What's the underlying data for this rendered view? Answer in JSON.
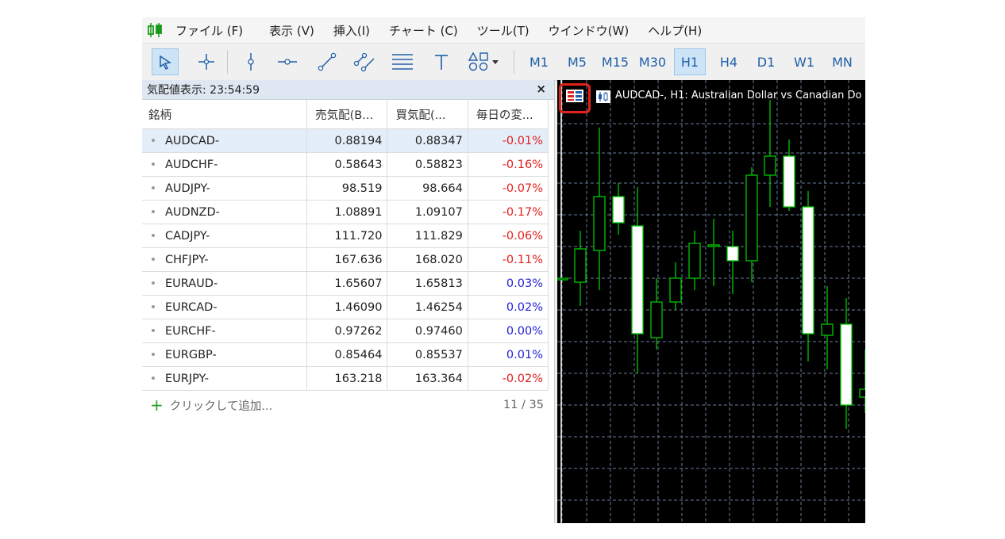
{
  "menu": [
    "ファイル (F)",
    "表示 (V)",
    "挿入(I)",
    "チャート (C)",
    "ツール(T)",
    "ウインドウ(W)",
    "ヘルプ(H)"
  ],
  "toolbar": {
    "tools": [
      "cursor-icon",
      "crosshair-icon",
      "vertical-line-icon",
      "horizontal-line-icon",
      "trendline-icon",
      "channel-icon",
      "fibonacci-icon",
      "text-icon",
      "shapes-icon"
    ],
    "timeframes": [
      "M1",
      "M5",
      "M15",
      "M30",
      "H1",
      "H4",
      "D1",
      "W1",
      "MN"
    ],
    "active_timeframe": "H1"
  },
  "market_watch": {
    "title": "気配値表示: 23:54:59",
    "columns": [
      "銘柄",
      "売気配(B...",
      "買気配(...",
      "毎日の変..."
    ],
    "rows": [
      {
        "symbol": "AUDCAD-",
        "bid": "0.88194",
        "ask": "0.88347",
        "change": "-0.01%"
      },
      {
        "symbol": "AUDCHF-",
        "bid": "0.58643",
        "ask": "0.58823",
        "change": "-0.16%"
      },
      {
        "symbol": "AUDJPY-",
        "bid": "98.519",
        "ask": "98.664",
        "change": "-0.07%"
      },
      {
        "symbol": "AUDNZD-",
        "bid": "1.08891",
        "ask": "1.09107",
        "change": "-0.17%"
      },
      {
        "symbol": "CADJPY-",
        "bid": "111.720",
        "ask": "111.829",
        "change": "-0.06%"
      },
      {
        "symbol": "CHFJPY-",
        "bid": "167.636",
        "ask": "168.020",
        "change": "-0.11%"
      },
      {
        "symbol": "EURAUD-",
        "bid": "1.65607",
        "ask": "1.65813",
        "change": "0.03%"
      },
      {
        "symbol": "EURCAD-",
        "bid": "1.46090",
        "ask": "1.46254",
        "change": "0.02%"
      },
      {
        "symbol": "EURCHF-",
        "bid": "0.97262",
        "ask": "0.97460",
        "change": "0.00%"
      },
      {
        "symbol": "EURGBP-",
        "bid": "0.85464",
        "ask": "0.85537",
        "change": "0.01%"
      },
      {
        "symbol": "EURJPY-",
        "bid": "163.218",
        "ask": "163.364",
        "change": "-0.02%"
      }
    ],
    "add_label": "クリックして追加...",
    "count": "11 / 35"
  },
  "chart": {
    "title": "AUDCAD-, H1:  Australian Dollar vs Canadian Do",
    "bull_color": "#00c800",
    "bear_body_color": "#ffffff",
    "grid_color": "#6a7c99",
    "background": "#000000"
  }
}
